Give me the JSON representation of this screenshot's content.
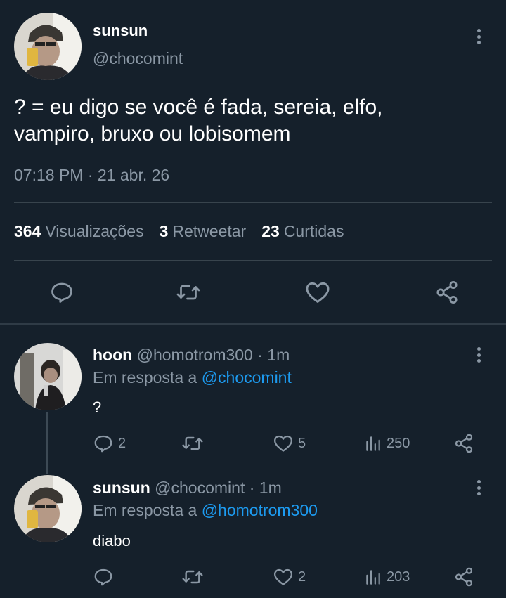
{
  "main_tweet": {
    "name": "sunsun",
    "handle": "@chocomint",
    "text_line1": "? = eu digo se você é fada, sereia, elfo,",
    "text_line2": "vampiro, bruxo ou lobisomem",
    "timestamp": "07:18 PM · 21 abr. 26",
    "stats": {
      "views_count": "364",
      "views_label": "Visualizações",
      "retweets_count": "3",
      "retweets_label": "Retweetar",
      "likes_count": "23",
      "likes_label": "Curtidas"
    },
    "actions": [
      "reply-icon",
      "retweet-icon",
      "like-icon",
      "share-icon"
    ]
  },
  "replies": [
    {
      "name": "hoon",
      "handle_time": "@homotrom300 · 1m",
      "reply_prefix": "Em resposta a",
      "reply_to": "@chocomint",
      "text": "?",
      "reply_count": "2",
      "retweet_count": "",
      "like_count": "5",
      "views_count": "250"
    },
    {
      "name": "sunsun",
      "handle_time": "@chocomint · 1m",
      "reply_prefix": "Em resposta a",
      "reply_to": "@homotrom300",
      "text": "diabo",
      "reply_count": "",
      "retweet_count": "",
      "like_count": "2",
      "views_count": "203"
    }
  ],
  "colors": {
    "background": "#15202b",
    "muted": "#8b98a5",
    "link": "#1d9bf0",
    "divider": "#38444d"
  }
}
